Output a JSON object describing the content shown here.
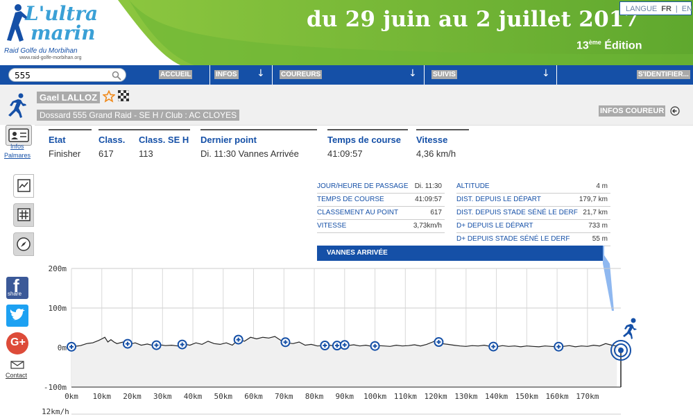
{
  "banner": {
    "logo_line1": "L'ultra",
    "logo_line2": "marin",
    "logo_tag": "Raid Golfe du Morbihan",
    "logo_url": "www.raid-golfe-morbihan.org",
    "dates": "du 29 juin au 2 juillet 2017",
    "edition_num": "13",
    "edition_sup": "ème",
    "edition_word": "Édition",
    "lang_label": "LANGUE",
    "lang_fr": "FR",
    "lang_sep": "|",
    "lang_en": "EN"
  },
  "nav": {
    "search_value": "555",
    "items": [
      "ACCUEIL",
      "INFOS",
      "COUREURS",
      "SUIVIS",
      "S'IDENTIFIER..."
    ]
  },
  "runner": {
    "name": "Gael LALLOZ",
    "subtitle": "Dossard 555   Grand Raid - SE H   /   Club : AC CLOYES",
    "infos_btn": "INFOS COUREUR"
  },
  "sidebar": {
    "infos": "Infos",
    "palmares": "Palmares",
    "share": "share",
    "contact": "Contact"
  },
  "stats": [
    {
      "title": "Etat",
      "value": "Finisher"
    },
    {
      "title": "Class.",
      "value": "617"
    },
    {
      "title": "Class. SE H",
      "value": "113"
    },
    {
      "title": "Dernier point",
      "value": "Di. 11:30   Vannes Arrivée"
    },
    {
      "title": "Temps de course",
      "value": "41:09:57"
    },
    {
      "title": "Vitesse",
      "value": "4,36 km/h"
    }
  ],
  "info_left": [
    {
      "label": "JOUR/HEURE DE PASSAGE",
      "value": "Di. 11:30"
    },
    {
      "label": "TEMPS DE COURSE",
      "value": "41:09:57"
    },
    {
      "label": "CLASSEMENT AU POINT",
      "value": "617"
    },
    {
      "label": "VITESSE",
      "value": "3,73km/h"
    }
  ],
  "info_right": [
    {
      "label": "ALTITUDE",
      "value": "4 m"
    },
    {
      "label": "DIST. DEPUIS LE DÉPART",
      "value": "179,7 km"
    },
    {
      "label": "DIST. DEPUIS STADE SÉNÉ LE DERF",
      "value": "21,7 km"
    },
    {
      "label": "D+ DEPUIS LE DÉPART",
      "value": "733 m"
    },
    {
      "label": "D+ DEPUIS STADE SÉNÉ LE DERF",
      "value": "55 m"
    }
  ],
  "point_name": "VANNES ARRIVÉE",
  "chart_data": {
    "type": "area",
    "ylabels": [
      "200m",
      "100m",
      "0m",
      "-100m"
    ],
    "yticks": [
      200,
      100,
      0,
      -100
    ],
    "ylim": [
      -100,
      200
    ],
    "xticks": [
      0,
      10,
      20,
      30,
      40,
      50,
      60,
      70,
      80,
      90,
      100,
      110,
      120,
      130,
      140,
      150,
      160,
      170
    ],
    "xlabels": [
      "0km",
      "10km",
      "20km",
      "30km",
      "40km",
      "50km",
      "60km",
      "70km",
      "80km",
      "90km",
      "100km",
      "110km",
      "120km",
      "130km",
      "140km",
      "150km",
      "160km",
      "170km"
    ],
    "xlim": [
      0,
      181
    ],
    "elevation_profile": [
      [
        0,
        2
      ],
      [
        3,
        5
      ],
      [
        5,
        10
      ],
      [
        7,
        12
      ],
      [
        9,
        18
      ],
      [
        10,
        22
      ],
      [
        11,
        26
      ],
      [
        12,
        14
      ],
      [
        13,
        20
      ],
      [
        14,
        14
      ],
      [
        15,
        10
      ],
      [
        17,
        14
      ],
      [
        19,
        8
      ],
      [
        21,
        12
      ],
      [
        23,
        6
      ],
      [
        25,
        9
      ],
      [
        27,
        5
      ],
      [
        29,
        7
      ],
      [
        31,
        5
      ],
      [
        33,
        6
      ],
      [
        35,
        4
      ],
      [
        37,
        9
      ],
      [
        39,
        6
      ],
      [
        41,
        12
      ],
      [
        43,
        8
      ],
      [
        45,
        16
      ],
      [
        47,
        10
      ],
      [
        49,
        8
      ],
      [
        51,
        12
      ],
      [
        53,
        6
      ],
      [
        55,
        20
      ],
      [
        57,
        16
      ],
      [
        59,
        26
      ],
      [
        61,
        22
      ],
      [
        63,
        26
      ],
      [
        65,
        24
      ],
      [
        67,
        28
      ],
      [
        69,
        18
      ],
      [
        71,
        12
      ],
      [
        73,
        10
      ],
      [
        75,
        14
      ],
      [
        77,
        6
      ],
      [
        79,
        8
      ],
      [
        81,
        4
      ],
      [
        83,
        5
      ],
      [
        85,
        6
      ],
      [
        87,
        4
      ],
      [
        89,
        8
      ],
      [
        91,
        5
      ],
      [
        93,
        7
      ],
      [
        95,
        4
      ],
      [
        97,
        6
      ],
      [
        99,
        3
      ],
      [
        101,
        5
      ],
      [
        103,
        4
      ],
      [
        105,
        3
      ],
      [
        107,
        6
      ],
      [
        109,
        4
      ],
      [
        111,
        5
      ],
      [
        113,
        7
      ],
      [
        115,
        4
      ],
      [
        117,
        8
      ],
      [
        119,
        14
      ],
      [
        120,
        18
      ],
      [
        122,
        10
      ],
      [
        124,
        8
      ],
      [
        126,
        6
      ],
      [
        128,
        4
      ],
      [
        130,
        3
      ],
      [
        132,
        5
      ],
      [
        134,
        4
      ],
      [
        136,
        6
      ],
      [
        138,
        3
      ],
      [
        140,
        2
      ],
      [
        142,
        5
      ],
      [
        144,
        3
      ],
      [
        146,
        4
      ],
      [
        148,
        2
      ],
      [
        150,
        4
      ],
      [
        152,
        3
      ],
      [
        154,
        2
      ],
      [
        156,
        4
      ],
      [
        158,
        3
      ],
      [
        160,
        2
      ],
      [
        162,
        3
      ],
      [
        164,
        5
      ],
      [
        166,
        2
      ],
      [
        168,
        4
      ],
      [
        170,
        3
      ],
      [
        172,
        6
      ],
      [
        174,
        4
      ],
      [
        176,
        10
      ],
      [
        178,
        6
      ],
      [
        179.7,
        4
      ]
    ],
    "checkpoints_km": [
      0,
      18.5,
      28,
      36.5,
      55,
      70.5,
      83.5,
      87.5,
      90,
      100,
      121,
      139,
      160.5
    ]
  },
  "speed_axis_label": "12km/h"
}
